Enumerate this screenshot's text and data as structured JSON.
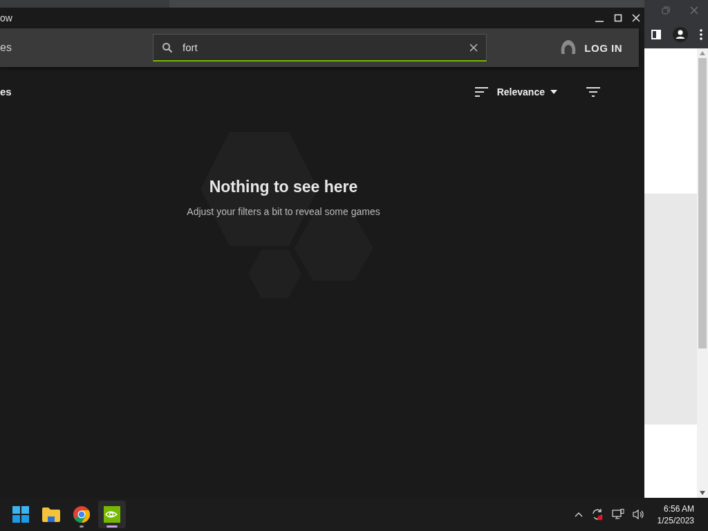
{
  "window": {
    "title": "ow"
  },
  "header": {
    "nav_label": "es",
    "search": {
      "value": "fort"
    },
    "login": "LOG IN"
  },
  "content": {
    "heading": "es",
    "sort": {
      "label": "Relevance"
    },
    "empty_state": {
      "title": "Nothing to see here",
      "message": "Adjust your filters a bit to reveal some games"
    }
  },
  "taskbar": {
    "apps": [
      {
        "kind": "start",
        "selected": false,
        "running": false
      },
      {
        "kind": "folder",
        "selected": false,
        "running": false
      },
      {
        "kind": "browser",
        "selected": false,
        "running": true
      },
      {
        "kind": "gpu",
        "selected": true,
        "running": true
      }
    ],
    "clock": {
      "time": "6:56 AM",
      "date": "1/25/2023"
    }
  }
}
